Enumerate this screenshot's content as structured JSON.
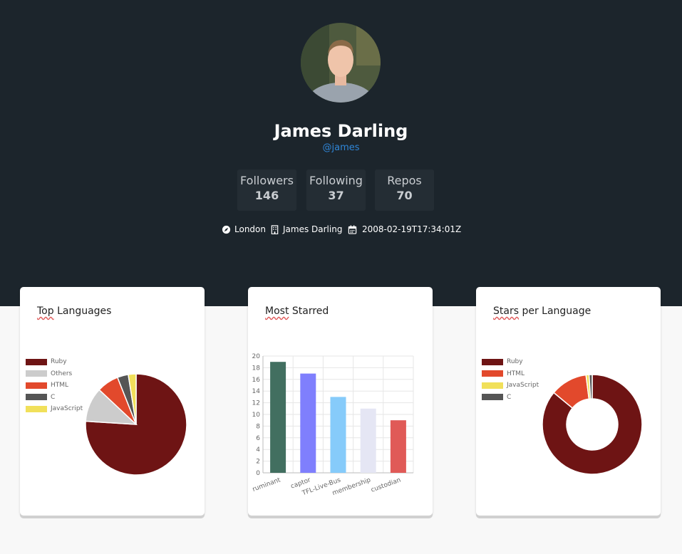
{
  "profile": {
    "name": "James Darling",
    "handle": "@james",
    "stats": [
      {
        "label": "Followers",
        "value": "146"
      },
      {
        "label": "Following",
        "value": "37"
      },
      {
        "label": "Repos",
        "value": "70"
      }
    ],
    "location": "London",
    "company": "James Darling",
    "joined": "2008-02-19T17:34:01Z"
  },
  "cards": {
    "top_languages_title": "Top Languages",
    "most_starred_title": "Most Starred",
    "stars_per_language_title": "Stars per Language"
  },
  "chart_data": [
    {
      "type": "pie",
      "title": "Top Languages",
      "labels": [
        "Ruby",
        "Others",
        "HTML",
        "C",
        "JavaScript"
      ],
      "values": [
        76,
        11,
        7,
        3.5,
        2.5
      ],
      "colors": [
        "#6e1414",
        "#cccccc",
        "#e2492c",
        "#555555",
        "#f1e05a"
      ]
    },
    {
      "type": "bar",
      "title": "Most Starred",
      "categories": [
        "ruminant",
        "captor",
        "TFL-Live-Bus",
        "membership",
        "custodian"
      ],
      "values": [
        19,
        17,
        13,
        11,
        9
      ],
      "colors": [
        "#426f60",
        "#7f7ffd",
        "#86cbfa",
        "#e5e6f4",
        "#e05a57"
      ],
      "ylim": [
        0,
        20
      ],
      "yticks": [
        0,
        2,
        4,
        6,
        8,
        10,
        12,
        14,
        16,
        18,
        20
      ],
      "grid": true
    },
    {
      "type": "pie",
      "subtype": "doughnut",
      "title": "Stars per Language",
      "labels": [
        "Ruby",
        "HTML",
        "JavaScript",
        "C"
      ],
      "values": [
        86,
        12,
        1,
        1
      ],
      "colors": [
        "#6e1414",
        "#e2492c",
        "#f1e05a",
        "#555555"
      ]
    }
  ]
}
